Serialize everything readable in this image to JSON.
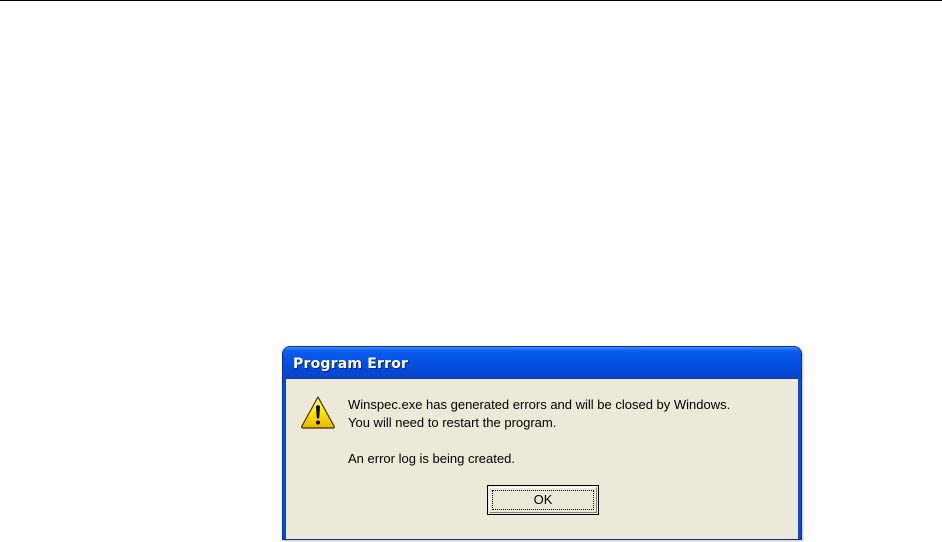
{
  "dialog": {
    "title": "Program Error",
    "icon": "warning-icon",
    "message_line1": "Winspec.exe has generated errors and will be closed by Windows.",
    "message_line2": "You will need to restart the program.",
    "message_line3": "An error log is being created.",
    "ok_label": "OK"
  },
  "colors": {
    "titlebar": "#0553e3",
    "dialog_face": "#ece9d8",
    "warning_yellow": "#ffe900"
  }
}
